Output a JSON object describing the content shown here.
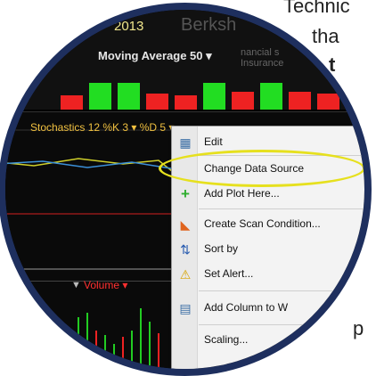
{
  "background": {
    "line1": "Technic",
    "line2": "tha",
    "line3": "t",
    "line4": "p"
  },
  "chart": {
    "title_year": "2013",
    "title_company": "Berksh",
    "moving_average_label": "Moving Average 50 ▾",
    "financial_label_1": "nancial s",
    "financial_label_2": "Insurance",
    "stochastics_label": "Stochastics 12 %K 3 ▾ %D 5 ▾",
    "volume_label": "Volume ▾",
    "colors": {
      "up": "#22dd22",
      "down": "#ee2222",
      "highlight": "#e6e01e",
      "lens": "#1e2f5e"
    }
  },
  "context_menu": {
    "items": [
      {
        "label": "Edit",
        "icon": "edit-icon"
      },
      {
        "label": "Change Data Source",
        "icon": "data-source-icon"
      },
      {
        "label": "Add Plot Here...",
        "icon": "add-plot-icon"
      },
      {
        "label": "Create Scan Condition...",
        "icon": "scan-condition-icon"
      },
      {
        "label": "Sort by",
        "icon": "sort-icon"
      },
      {
        "label": "Set Alert...",
        "icon": "alert-icon"
      },
      {
        "label": "Add Column to W",
        "icon": "add-column-icon"
      },
      {
        "label": "Scaling...",
        "icon": "scaling-icon"
      }
    ]
  }
}
